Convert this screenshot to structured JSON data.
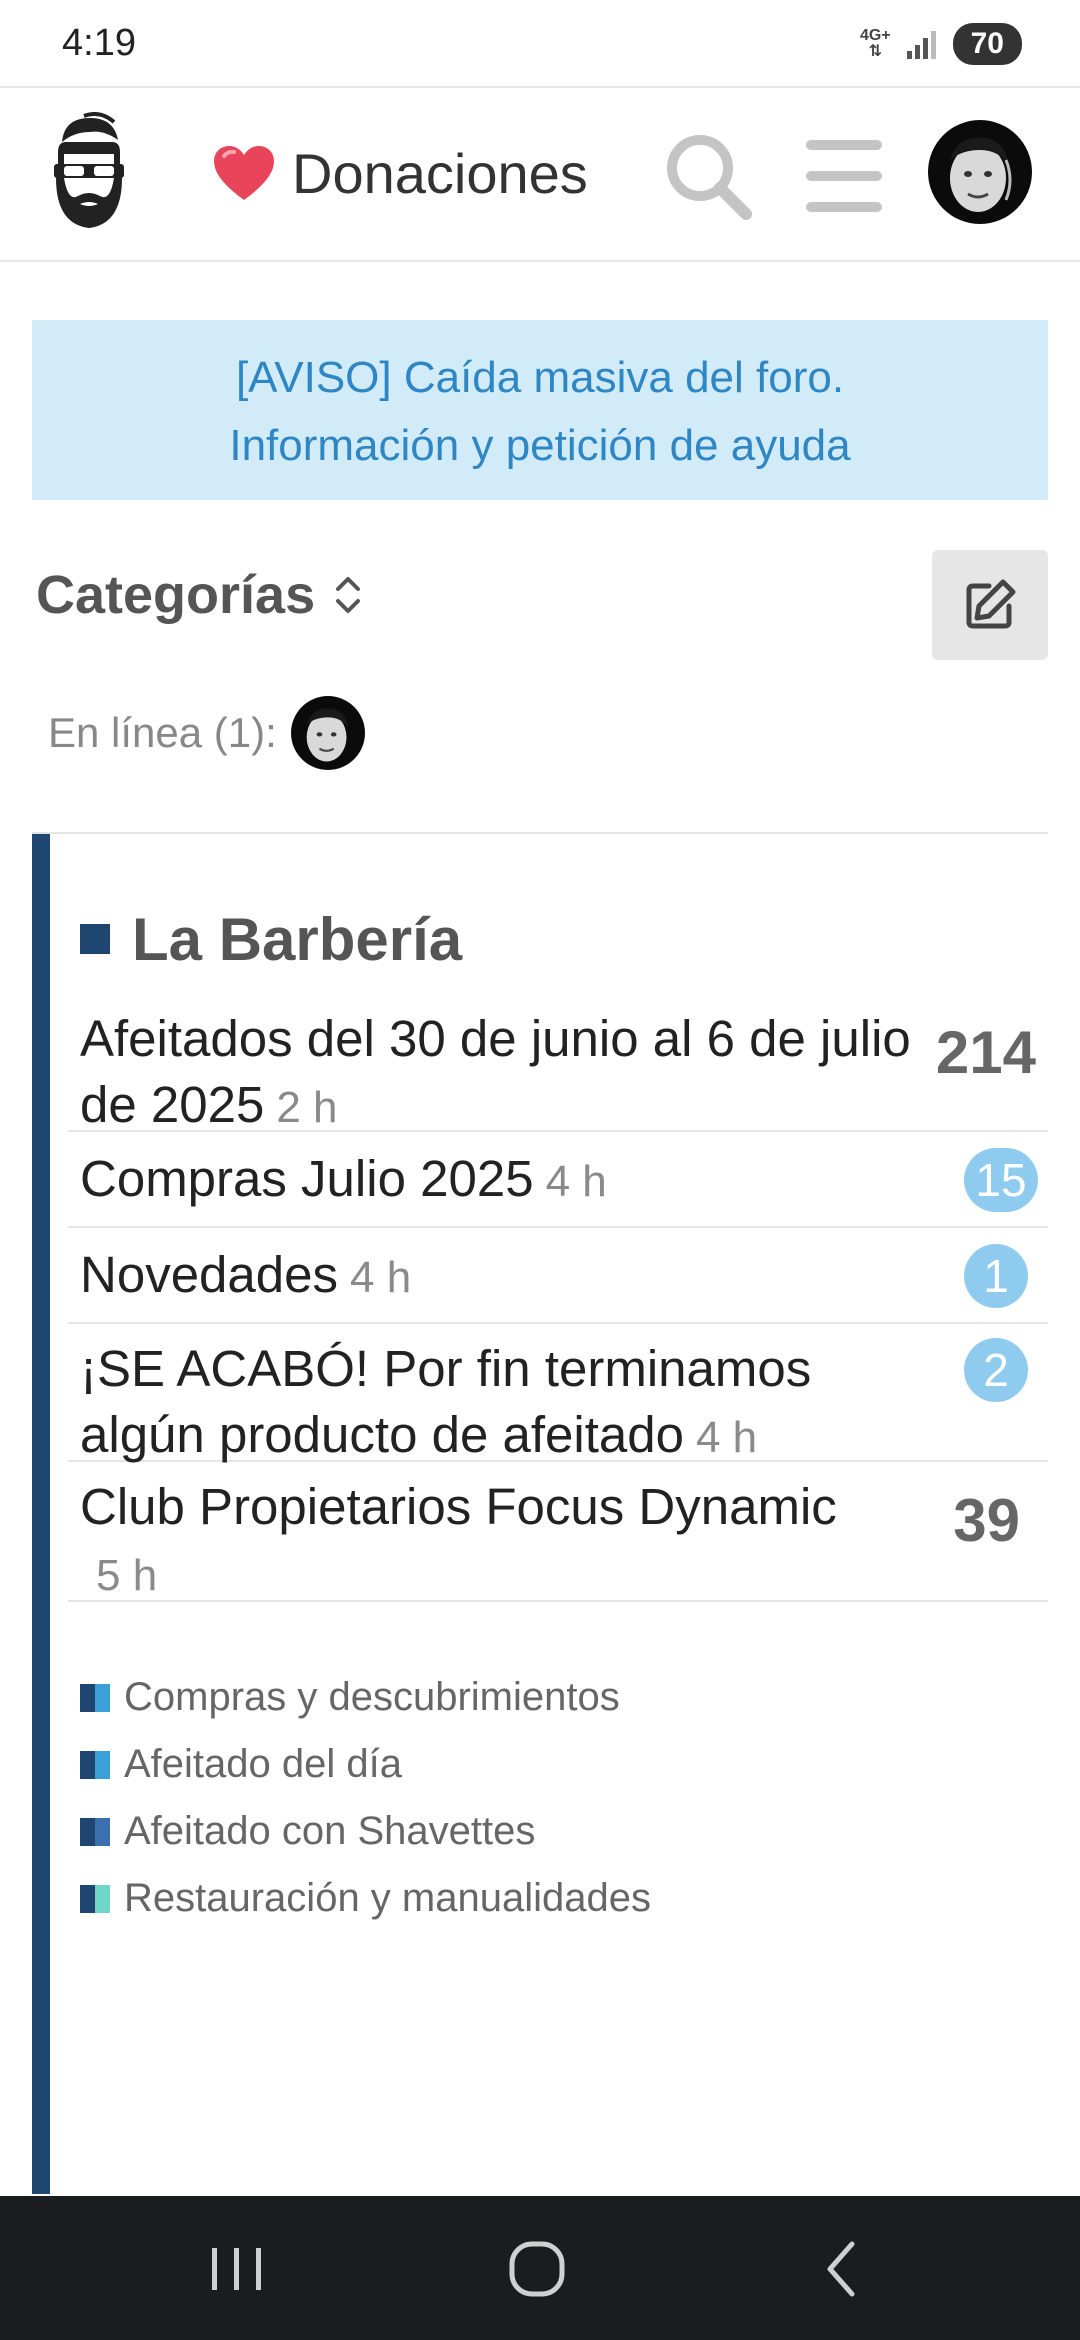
{
  "status_bar": {
    "time": "4:19",
    "network": "4G+",
    "battery": "70"
  },
  "header": {
    "donate_label": "Donaciones",
    "icons": [
      "bearded-logo-icon",
      "heart-icon",
      "search-icon",
      "hamburger-menu-icon",
      "user-avatar"
    ]
  },
  "banner": {
    "line1": "[AVISO] Caída masiva del foro.",
    "line2": "Información y petición de ayuda"
  },
  "categories": {
    "heading": "Categorías",
    "online_label": "En línea (1):"
  },
  "category": {
    "name": "La Barbería",
    "color": "#1f4670",
    "topics": [
      {
        "title": "Afeitados del 30 de junio al 6 de julio de 2025",
        "age": "2 h",
        "count": "214",
        "count_style": "plain"
      },
      {
        "title": "Compras Julio 2025",
        "age": "4 h",
        "count": "15",
        "count_style": "badge"
      },
      {
        "title": "Novedades",
        "age": "4 h",
        "count": "1",
        "count_style": "badge"
      },
      {
        "title": "¡SE ACABÓ! Por fin terminamos algún producto de afeitado",
        "age": "4 h",
        "count": "2",
        "count_style": "badge"
      },
      {
        "title": "Club Propietarios Focus Dynamic",
        "age": "5 h",
        "count": "39",
        "count_style": "plain"
      }
    ],
    "subcategories": [
      {
        "name": "Compras y descubrimientos",
        "colors": [
          "#1f4670",
          "#3ba0d8"
        ]
      },
      {
        "name": "Afeitado del día",
        "colors": [
          "#1f4670",
          "#3ba0d8"
        ]
      },
      {
        "name": "Afeitado con Shavettes",
        "colors": [
          "#1f4670",
          "#3a6fb0"
        ]
      },
      {
        "name": "Restauración y manualidades",
        "colors": [
          "#1f4670",
          "#6fd6c9"
        ]
      }
    ]
  },
  "colors": {
    "banner_bg": "#d1ecf8",
    "banner_text": "#2f86c5",
    "badge": "#8fcbee"
  }
}
